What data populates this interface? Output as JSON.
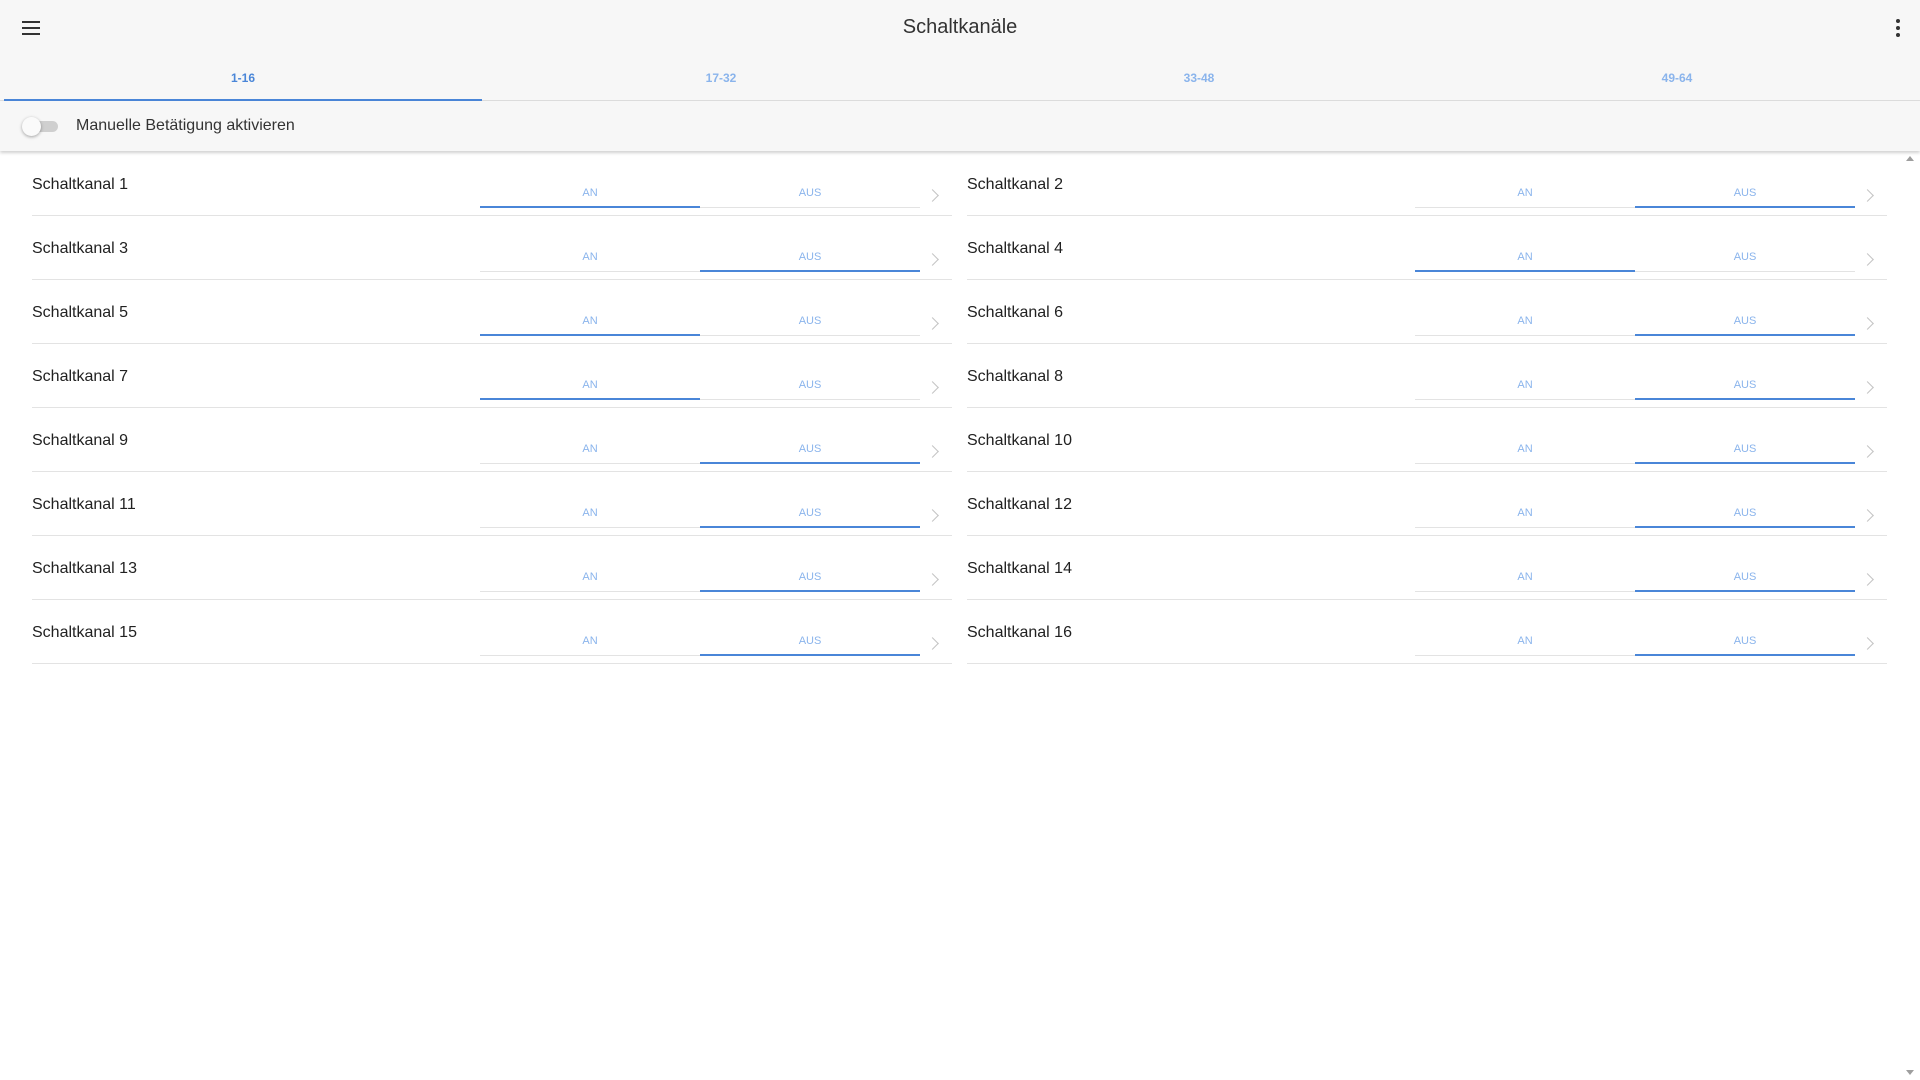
{
  "header": {
    "title": "Schaltkanäle",
    "menu_icon": "hamburger-menu-icon",
    "overflow_icon": "more-vert-icon"
  },
  "tabs": [
    {
      "label": "1-16",
      "active": true
    },
    {
      "label": "17-32",
      "active": false
    },
    {
      "label": "33-48",
      "active": false
    },
    {
      "label": "49-64",
      "active": false
    }
  ],
  "manual": {
    "label": "Manuelle Betätigung aktivieren",
    "enabled": false
  },
  "colors": {
    "accent": "#4a86d8",
    "accent_light": "#8ab4ec",
    "bar_bg": "#f7f7f7"
  },
  "segment_labels": {
    "on": "AN",
    "off": "AUS"
  },
  "channels": [
    {
      "name": "Schaltkanal 1",
      "state": "AN"
    },
    {
      "name": "Schaltkanal 2",
      "state": "AUS"
    },
    {
      "name": "Schaltkanal 3",
      "state": "AUS"
    },
    {
      "name": "Schaltkanal 4",
      "state": "AN"
    },
    {
      "name": "Schaltkanal 5",
      "state": "AN"
    },
    {
      "name": "Schaltkanal 6",
      "state": "AUS"
    },
    {
      "name": "Schaltkanal 7",
      "state": "AN"
    },
    {
      "name": "Schaltkanal 8",
      "state": "AUS"
    },
    {
      "name": "Schaltkanal 9",
      "state": "AUS"
    },
    {
      "name": "Schaltkanal 10",
      "state": "AUS"
    },
    {
      "name": "Schaltkanal 11",
      "state": "AUS"
    },
    {
      "name": "Schaltkanal 12",
      "state": "AUS"
    },
    {
      "name": "Schaltkanal 13",
      "state": "AUS"
    },
    {
      "name": "Schaltkanal 14",
      "state": "AUS"
    },
    {
      "name": "Schaltkanal 15",
      "state": "AUS"
    },
    {
      "name": "Schaltkanal 16",
      "state": "AUS"
    }
  ]
}
